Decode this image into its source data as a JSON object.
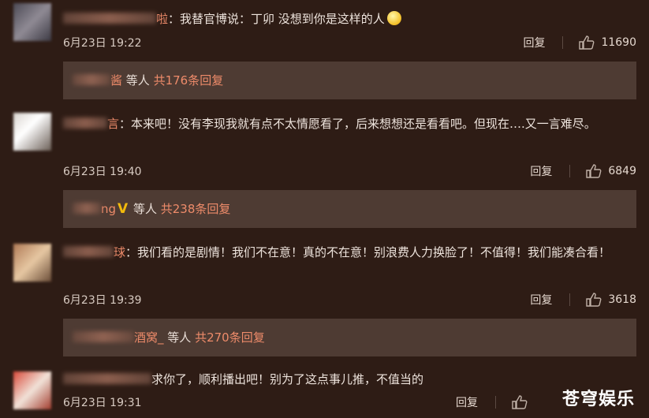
{
  "comments": [
    {
      "name_suffix": "啦",
      "text": "：我替官博说：丁卯 没想到你是这样的人",
      "time": "6月23日 19:22",
      "reply_label": "回复",
      "likes": "11690",
      "replies": {
        "name_suffix": "酱",
        "label": " 等人 ",
        "count_text": "共176条回复"
      }
    },
    {
      "name_suffix": "言",
      "text": "：本来吧！没有李现我就有点不太情愿看了，后来想想还是看看吧。但现在….又一言难尽。",
      "time": "6月23日 19:40",
      "reply_label": "回复",
      "likes": "6849",
      "replies": {
        "name_suffix": "ng",
        "label": " 等人 ",
        "count_text": "共238条回复"
      }
    },
    {
      "name_suffix": "球",
      "text": "：我们看的是剧情！我们不在意！真的不在意！别浪费人力换脸了！不值得！我们能凑合看！",
      "time": "6月23日 19:39",
      "reply_label": "回复",
      "likes": "3618",
      "replies": {
        "name_suffix": "酒窝_",
        "label": " 等人 ",
        "count_text": "共270条回复"
      }
    },
    {
      "name_suffix": "",
      "text": "求你了，顺利播出吧！别为了这点事儿推，不值当的",
      "time": "6月23日 19:31",
      "reply_label": "回复",
      "likes": ""
    }
  ],
  "watermark": "苍穹娱乐",
  "colors": {
    "background": "#2e1c15",
    "reply_box": "#4e3b33",
    "accent": "#ee8b6a",
    "v_badge": "#f1b90c"
  },
  "icons": {
    "like": "thumbs-up-icon",
    "emoji": "smile-emoji-icon",
    "verified": "verified-v-icon"
  }
}
